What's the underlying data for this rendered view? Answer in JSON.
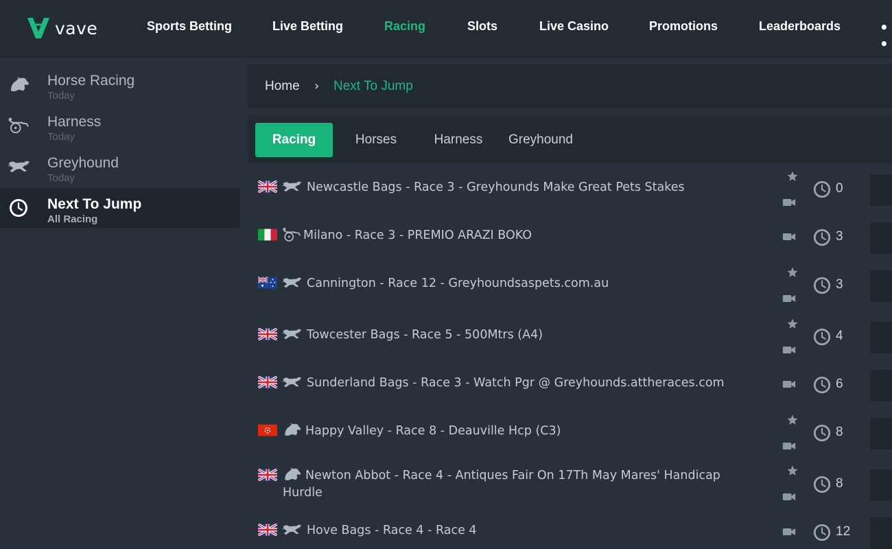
{
  "brand": {
    "name": "vave",
    "accent": "#1fb882"
  },
  "nav": {
    "items": [
      {
        "label": "Sports Betting"
      },
      {
        "label": "Live Betting"
      },
      {
        "label": "Racing",
        "active": true
      },
      {
        "label": "Slots"
      },
      {
        "label": "Live Casino"
      },
      {
        "label": "Promotions"
      },
      {
        "label": "Leaderboards"
      }
    ],
    "more": "• •"
  },
  "sidebar": {
    "items": [
      {
        "title": "Horse Racing",
        "subtitle": "Today",
        "icon": "horse-icon"
      },
      {
        "title": "Harness",
        "subtitle": "Today",
        "icon": "harness-icon"
      },
      {
        "title": "Greyhound",
        "subtitle": "Today",
        "icon": "greyhound-icon"
      },
      {
        "title": "Next To Jump",
        "subtitle": "All Racing",
        "icon": "clock-icon",
        "active": true
      }
    ]
  },
  "breadcrumb": {
    "home": "Home",
    "separator": "›",
    "current": "Next To Jump"
  },
  "tabs": [
    {
      "label": "Racing",
      "active": true
    },
    {
      "label": "Horses"
    },
    {
      "label": "Harness"
    },
    {
      "label": "Greyhound"
    }
  ],
  "races": [
    {
      "flag": "uk",
      "type": "greyhound",
      "name": "Newcastle Bags - Race 3 - Greyhounds Make Great Pets Stakes",
      "favourite": true,
      "stream": true,
      "minutes": "0"
    },
    {
      "flag": "it",
      "type": "harness",
      "name": "Milano - Race 3 - PREMIO ARAZI BOKO",
      "favourite": false,
      "stream": true,
      "minutes": "3"
    },
    {
      "flag": "au",
      "type": "greyhound",
      "name": "Cannington - Race 12 - Greyhoundsaspets.com.au",
      "favourite": true,
      "stream": true,
      "minutes": "3"
    },
    {
      "flag": "uk",
      "type": "greyhound",
      "name": "Towcester Bags - Race 5 - 500Mtrs (A4)",
      "favourite": true,
      "stream": true,
      "minutes": "4"
    },
    {
      "flag": "uk",
      "type": "greyhound",
      "name": "Sunderland Bags - Race 3 - Watch Pgr @ Greyhounds.attheraces.com",
      "favourite": false,
      "stream": true,
      "minutes": "6"
    },
    {
      "flag": "hk",
      "type": "horse",
      "name": "Happy Valley - Race 8 - Deauville Hcp (C3)",
      "favourite": true,
      "stream": true,
      "minutes": "8"
    },
    {
      "flag": "uk",
      "type": "horse",
      "name": "Newton Abbot - Race 4 - Antiques Fair On 17Th May Mares' Handicap Hurdle",
      "favourite": true,
      "stream": true,
      "minutes": "8"
    },
    {
      "flag": "uk",
      "type": "greyhound",
      "name": "Hove Bags - Race 4 - Race 4",
      "favourite": false,
      "stream": true,
      "minutes": "12"
    }
  ]
}
